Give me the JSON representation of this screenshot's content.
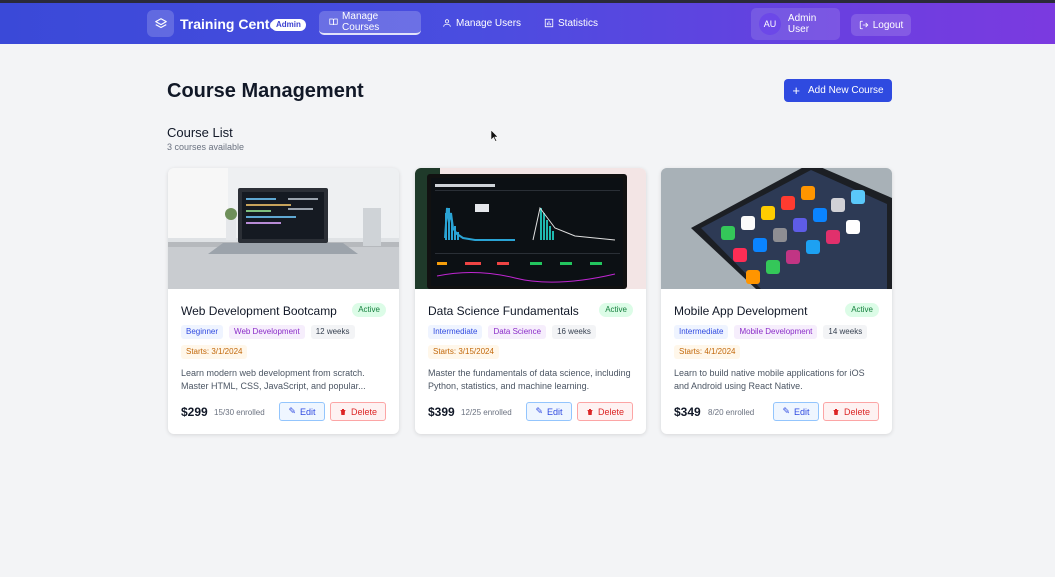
{
  "app": {
    "brand": "Training Center",
    "role_badge": "Admin"
  },
  "nav": {
    "items": [
      {
        "label": "Manage Courses",
        "icon": "book-icon",
        "active": true
      },
      {
        "label": "Manage Users",
        "icon": "users-icon",
        "active": false
      },
      {
        "label": "Statistics",
        "icon": "bar-chart-icon",
        "active": false
      }
    ],
    "user": {
      "initials": "AU",
      "name": "Admin User"
    },
    "logout_label": "Logout"
  },
  "page": {
    "title": "Course Management",
    "add_button": "Add New Course",
    "section_title": "Course List",
    "section_subtitle": "3 courses available"
  },
  "courses": [
    {
      "title": "Web Development Bootcamp",
      "status": "Active",
      "level": "Beginner",
      "category": "Web Development",
      "duration": "12 weeks",
      "starts": "Starts: 3/1/2024",
      "description": "Learn modern web development from scratch. Master HTML, CSS, JavaScript, and popular...",
      "price": "$299",
      "enrolled": "15/30 enrolled",
      "edit_label": "Edit",
      "delete_label": "Delete"
    },
    {
      "title": "Data Science Fundamentals",
      "status": "Active",
      "level": "Intermediate",
      "category": "Data Science",
      "duration": "16 weeks",
      "starts": "Starts: 3/15/2024",
      "description": "Master the fundamentals of data science, including Python, statistics, and machine learning.",
      "price": "$399",
      "enrolled": "12/25 enrolled",
      "edit_label": "Edit",
      "delete_label": "Delete"
    },
    {
      "title": "Mobile App Development",
      "status": "Active",
      "level": "Intermediate",
      "category": "Mobile Development",
      "duration": "14 weeks",
      "starts": "Starts: 4/1/2024",
      "description": "Learn to build native mobile applications for iOS and Android using React Native.",
      "price": "$349",
      "enrolled": "8/20 enrolled",
      "edit_label": "Edit",
      "delete_label": "Delete"
    }
  ],
  "colors": {
    "primary": "#2f4ae0",
    "header_start": "#3a49d8",
    "header_end": "#7b3ae0",
    "active_green": "#15803d",
    "danger": "#dc2626"
  }
}
